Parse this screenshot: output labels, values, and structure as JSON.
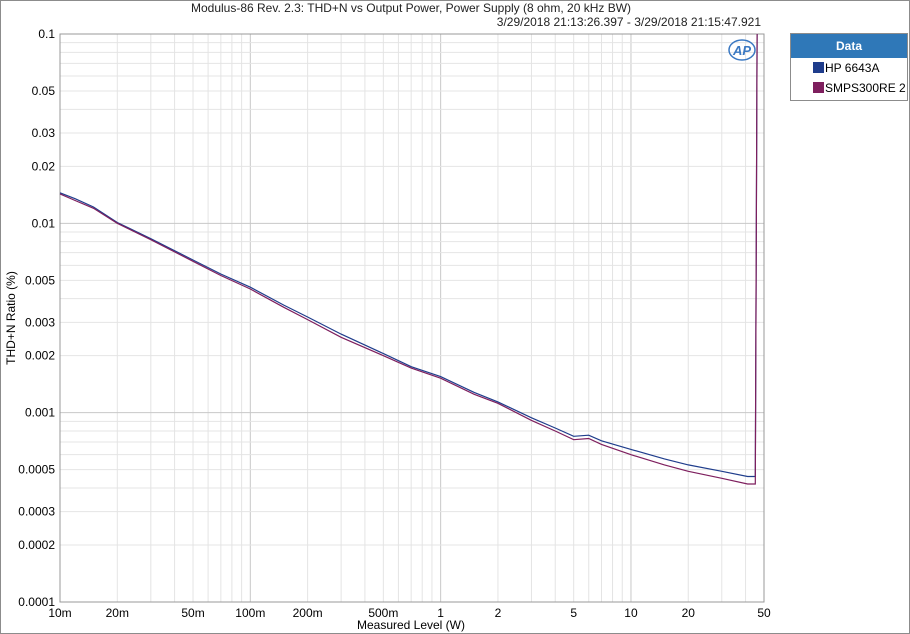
{
  "chart_data": {
    "type": "line",
    "title": "Modulus-86 Rev. 2.3: THD+N vs Output Power, Power Supply (8 ohm, 20 kHz BW)",
    "subtitle": "3/29/2018 21:13:26.397 - 3/29/2018 21:15:47.921",
    "xlabel": "Measured Level (W)",
    "ylabel": "THD+N Ratio (%)",
    "xscale": "log",
    "yscale": "log",
    "xlim": [
      0.01,
      50
    ],
    "ylim": [
      0.0001,
      0.1
    ],
    "x_ticks": [
      {
        "v": 0.01,
        "label": "10m"
      },
      {
        "v": 0.02,
        "label": "20m"
      },
      {
        "v": 0.05,
        "label": "50m"
      },
      {
        "v": 0.1,
        "label": "100m"
      },
      {
        "v": 0.2,
        "label": "200m"
      },
      {
        "v": 0.5,
        "label": "500m"
      },
      {
        "v": 1,
        "label": "1"
      },
      {
        "v": 2,
        "label": "2"
      },
      {
        "v": 5,
        "label": "5"
      },
      {
        "v": 10,
        "label": "10"
      },
      {
        "v": 20,
        "label": "20"
      },
      {
        "v": 50,
        "label": "50"
      }
    ],
    "y_ticks": [
      {
        "v": 0.1,
        "label": "0.1"
      },
      {
        "v": 0.05,
        "label": "0.05"
      },
      {
        "v": 0.03,
        "label": "0.03"
      },
      {
        "v": 0.02,
        "label": "0.02"
      },
      {
        "v": 0.01,
        "label": "0.01"
      },
      {
        "v": 0.005,
        "label": "0.005"
      },
      {
        "v": 0.003,
        "label": "0.003"
      },
      {
        "v": 0.002,
        "label": "0.002"
      },
      {
        "v": 0.001,
        "label": "0.001"
      },
      {
        "v": 0.0005,
        "label": "0.0005"
      },
      {
        "v": 0.0003,
        "label": "0.0003"
      },
      {
        "v": 0.0002,
        "label": "0.0002"
      },
      {
        "v": 0.0001,
        "label": "0.0001"
      }
    ],
    "grid": true,
    "legend_title": "Data",
    "legend_position": "top-right outside",
    "series": [
      {
        "name": "HP 6643A",
        "color": "#1f3d8c",
        "points": [
          [
            0.01,
            0.0145
          ],
          [
            0.012,
            0.0135
          ],
          [
            0.015,
            0.0122
          ],
          [
            0.02,
            0.0101
          ],
          [
            0.03,
            0.0083
          ],
          [
            0.05,
            0.0064
          ],
          [
            0.07,
            0.0054
          ],
          [
            0.1,
            0.0046
          ],
          [
            0.15,
            0.0037
          ],
          [
            0.2,
            0.0032
          ],
          [
            0.3,
            0.0026
          ],
          [
            0.5,
            0.00205
          ],
          [
            0.7,
            0.00175
          ],
          [
            1.0,
            0.00155
          ],
          [
            1.5,
            0.00128
          ],
          [
            2.0,
            0.00114
          ],
          [
            3.0,
            0.00094
          ],
          [
            4.0,
            0.00083
          ],
          [
            5.0,
            0.00075
          ],
          [
            6.0,
            0.00076
          ],
          [
            7.0,
            0.00071
          ],
          [
            10.0,
            0.00064
          ],
          [
            15.0,
            0.00057
          ],
          [
            20.0,
            0.00053
          ],
          [
            30.0,
            0.00049
          ],
          [
            41.0,
            0.00046
          ],
          [
            45.0,
            0.00046
          ],
          [
            46.0,
            0.1
          ]
        ]
      },
      {
        "name": "SMPS300RE 2",
        "color": "#7e1f5e",
        "points": [
          [
            0.01,
            0.0143
          ],
          [
            0.012,
            0.0132
          ],
          [
            0.015,
            0.012
          ],
          [
            0.02,
            0.01
          ],
          [
            0.03,
            0.0082
          ],
          [
            0.05,
            0.0063
          ],
          [
            0.07,
            0.0053
          ],
          [
            0.1,
            0.0045
          ],
          [
            0.15,
            0.0036
          ],
          [
            0.2,
            0.0031
          ],
          [
            0.3,
            0.0025
          ],
          [
            0.5,
            0.002
          ],
          [
            0.7,
            0.00172
          ],
          [
            1.0,
            0.00152
          ],
          [
            1.5,
            0.00125
          ],
          [
            2.0,
            0.00112
          ],
          [
            3.0,
            0.00091
          ],
          [
            4.0,
            0.0008
          ],
          [
            5.0,
            0.00072
          ],
          [
            6.0,
            0.00073
          ],
          [
            7.0,
            0.00068
          ],
          [
            10.0,
            0.0006
          ],
          [
            15.0,
            0.00053
          ],
          [
            20.0,
            0.00049
          ],
          [
            30.0,
            0.00045
          ],
          [
            41.0,
            0.00042
          ],
          [
            45.0,
            0.00042
          ],
          [
            46.0,
            0.1
          ]
        ]
      }
    ]
  },
  "logo_text": "AP"
}
